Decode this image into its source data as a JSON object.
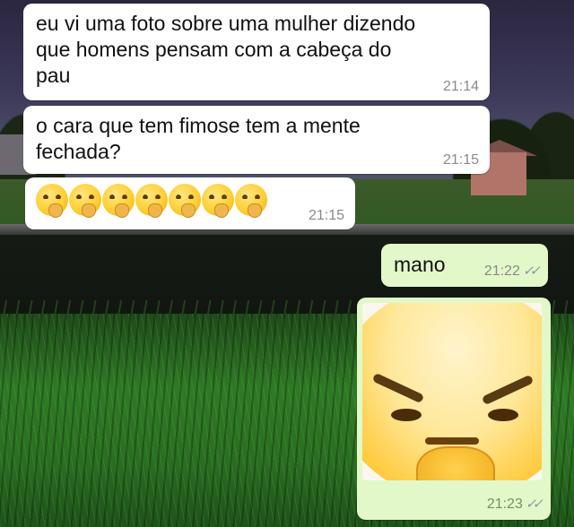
{
  "messages": [
    {
      "direction": "in",
      "text": "eu vi uma foto sobre uma mulher dizendo\nque homens pensam com a cabeça do\npau",
      "time": "21:14"
    },
    {
      "direction": "in",
      "text": "o cara que tem fimose tem a mente\nfechada?",
      "time": "21:15"
    },
    {
      "direction": "in",
      "emoji": "thinking-face",
      "emoji_count": 7,
      "time": "21:15"
    },
    {
      "direction": "out",
      "text": "mano",
      "time": "21:22",
      "status": "read"
    },
    {
      "direction": "out",
      "image": "zoomed-thinking-face-sticker",
      "time": "21:23",
      "status": "read"
    }
  ],
  "ticks_glyph": "✓✓",
  "colors": {
    "incoming_bubble": "#ffffff",
    "outgoing_bubble": "#e2f8c9",
    "timestamp": "#8a8a8a",
    "read_ticks": "#8a97a3"
  }
}
